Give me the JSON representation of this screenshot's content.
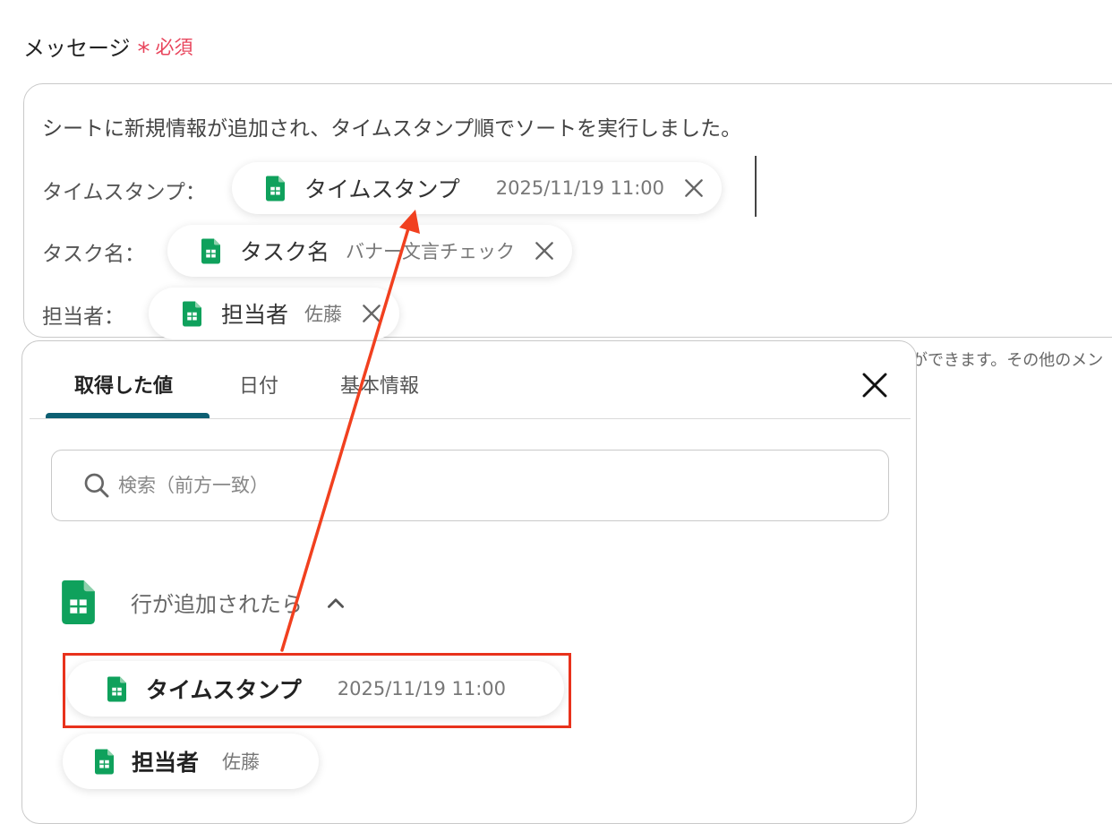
{
  "field": {
    "label": "メッセージ",
    "required_mark": "*",
    "required_text": "必須"
  },
  "message": {
    "line1": "シートに新規情報が追加され、タイムスタンプ順でソートを実行しました。",
    "rows": [
      {
        "label": "タイムスタンプ：",
        "chip_name": "タイムスタンプ",
        "chip_value": "2025/11/19 11:00"
      },
      {
        "label": "タスク名：",
        "chip_name": "タスク名",
        "chip_value": "バナー文言チェック"
      },
      {
        "label": "担当者：",
        "chip_name": "担当者",
        "chip_value": "佐藤"
      }
    ]
  },
  "hint": "ができます。その他のメン",
  "picker": {
    "tabs": [
      {
        "label": "取得した値",
        "active": true
      },
      {
        "label": "日付",
        "active": false
      },
      {
        "label": "基本情報",
        "active": false
      }
    ],
    "search_placeholder": "検索（前方一致）",
    "group": {
      "label": "行が追加されたら",
      "items": [
        {
          "name": "タイムスタンプ",
          "value": "2025/11/19 11:00"
        },
        {
          "name": "担当者",
          "value": "佐藤"
        }
      ]
    }
  },
  "colors": {
    "required": "#e8455c",
    "tab_active_underline": "#0d5f72",
    "highlight": "#e8321c",
    "sheets_green": "#0fa15c"
  }
}
